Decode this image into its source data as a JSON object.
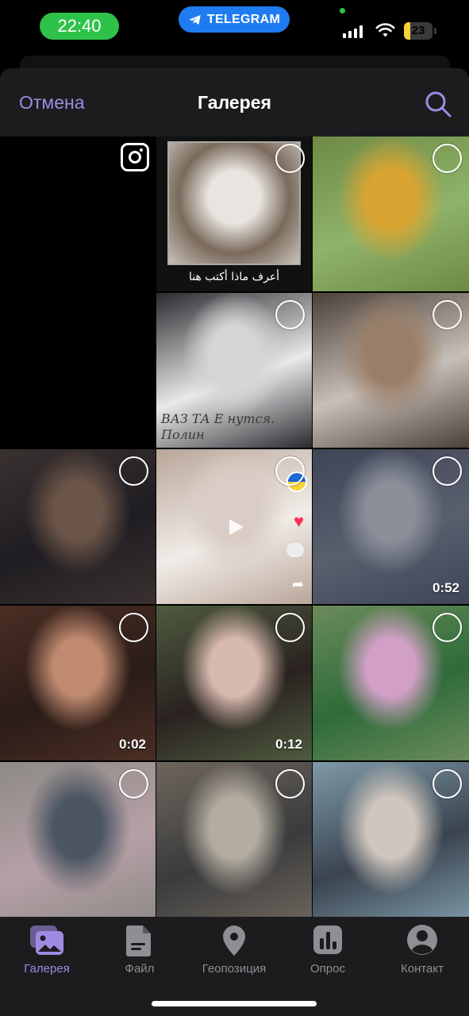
{
  "status_bar": {
    "time": "22:40",
    "app_badge": "TELEGRAM",
    "battery_level": 23,
    "battery_label": "23",
    "icons": [
      "signal-icon",
      "wifi-icon",
      "battery-icon",
      "telegram-icon"
    ]
  },
  "header": {
    "cancel_label": "Отмена",
    "title": "Галерея",
    "search_icon": "search-icon"
  },
  "gallery": {
    "camera_icon": "camera-icon",
    "items": [
      {
        "type": "photo",
        "caption": "أعرف ماذا أكتب هنا",
        "colors": [
          "#e8e4df",
          "#7a6a5c",
          "#c9c2b8"
        ]
      },
      {
        "type": "photo",
        "colors": [
          "#6e8a44",
          "#d9a431",
          "#8fb36a"
        ]
      },
      {
        "type": "photo",
        "snow_text": "ВАЗ ТА Е нутся. Полин",
        "colors": [
          "#2a2a2e",
          "#d7d4d6",
          "#eae8ea"
        ]
      },
      {
        "type": "photo",
        "colors": [
          "#4b4038",
          "#9a7f68",
          "#c7bfb9"
        ]
      },
      {
        "type": "photo",
        "colors": [
          "#3a3130",
          "#6b5548",
          "#1f1d22"
        ]
      },
      {
        "type": "video",
        "colors": [
          "#b9a699",
          "#d9cdc5",
          "#f1ece8"
        ]
      },
      {
        "type": "video",
        "duration": "0:52",
        "colors": [
          "#3e4556",
          "#8a8f9a",
          "#5a5f6e"
        ]
      },
      {
        "type": "video",
        "duration": "0:02",
        "colors": [
          "#4a2e24",
          "#c08a70",
          "#2b1c18"
        ]
      },
      {
        "type": "video",
        "duration": "0:12",
        "colors": [
          "#4e5b3f",
          "#d7b9ae",
          "#2a2220"
        ]
      },
      {
        "type": "photo",
        "colors": [
          "#6b8b5b",
          "#d2a0c6",
          "#2f6b3a"
        ]
      },
      {
        "type": "photo",
        "colors": [
          "#8d8a86",
          "#4c5663",
          "#b6a0a6"
        ]
      },
      {
        "type": "photo",
        "colors": [
          "#6e665c",
          "#b3aca0",
          "#3a3b3d"
        ]
      },
      {
        "type": "photo",
        "colors": [
          "#7f9aa8",
          "#cfc6bd",
          "#3a4450"
        ]
      }
    ]
  },
  "tabbar": {
    "tabs": [
      {
        "label": "Галерея",
        "icon": "gallery-icon",
        "active": true
      },
      {
        "label": "Файл",
        "icon": "file-icon",
        "active": false
      },
      {
        "label": "Геопозиция",
        "icon": "location-icon",
        "active": false
      },
      {
        "label": "Опрос",
        "icon": "poll-icon",
        "active": false
      },
      {
        "label": "Контакт",
        "icon": "contact-icon",
        "active": false
      }
    ]
  },
  "colors": {
    "accent": "#9f8be3",
    "header_bg": "#1c1c1e",
    "tab_inactive": "#8e8e93",
    "time_pill": "#2fc24a",
    "telegram_pill": "#1f7cf0",
    "battery": "#f6d13a"
  }
}
